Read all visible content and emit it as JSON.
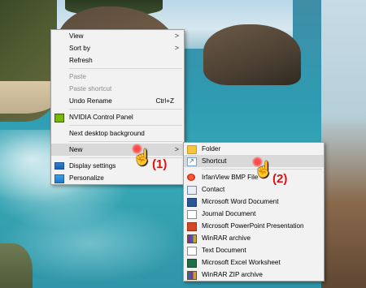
{
  "main_menu": {
    "items": [
      {
        "label": "View",
        "submenu": true
      },
      {
        "label": "Sort by",
        "submenu": true
      },
      {
        "label": "Refresh"
      },
      {
        "label": "Paste",
        "disabled": true
      },
      {
        "label": "Paste shortcut",
        "disabled": true
      },
      {
        "label": "Undo Rename",
        "shortcut": "Ctrl+Z"
      },
      {
        "label": "NVIDIA Control Panel",
        "icon": "nvidia-icon"
      },
      {
        "label": "Next desktop background"
      },
      {
        "label": "New",
        "submenu": true,
        "highlighted": true
      },
      {
        "label": "Display settings",
        "icon": "display-settings-icon"
      },
      {
        "label": "Personalize",
        "icon": "personalize-icon"
      }
    ],
    "arrow_glyph": ">"
  },
  "new_submenu": {
    "items": [
      {
        "label": "Folder",
        "icon": "folder-icon"
      },
      {
        "label": "Shortcut",
        "icon": "shortcut-icon",
        "highlighted": true
      },
      {
        "label": "IrfanView BMP File",
        "icon": "irfanview-icon"
      },
      {
        "label": "Contact",
        "icon": "contact-icon"
      },
      {
        "label": "Microsoft Word Document",
        "icon": "word-icon"
      },
      {
        "label": "Journal Document",
        "icon": "journal-icon"
      },
      {
        "label": "Microsoft PowerPoint Presentation",
        "icon": "powerpoint-icon"
      },
      {
        "label": "WinRAR archive",
        "icon": "winrar-icon"
      },
      {
        "label": "Text Document",
        "icon": "text-document-icon"
      },
      {
        "label": "Microsoft Excel Worksheet",
        "icon": "excel-icon"
      },
      {
        "label": "WinRAR ZIP archive",
        "icon": "winrar-zip-icon"
      }
    ]
  },
  "annotations": {
    "step1": "(1)",
    "step2": "(2)",
    "pointer_glyph": "☝",
    "accent_color": "#e01010"
  }
}
